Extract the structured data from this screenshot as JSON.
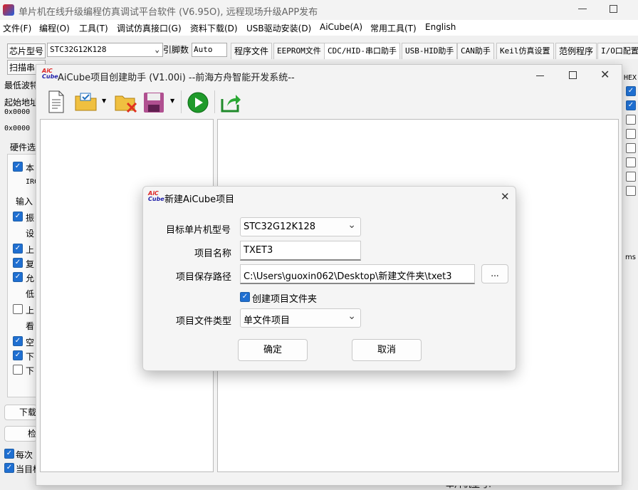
{
  "main_window": {
    "title": "单片机在线升级编程仿真调试平台软件 (V6.95O), 远程现场升级APP发布",
    "menu": [
      "文件(F)",
      "编程(O)",
      "工具(T)",
      "调试仿真接口(G)",
      "资料下载(D)",
      "USB驱动安装(D)",
      "AiCube(A)",
      "常用工具(T)",
      "English"
    ],
    "chip_label": "芯片型号",
    "chip_value": "STC32G12K128",
    "pins_label": "引脚数",
    "pins_value": "Auto",
    "scan_button": "扫描串口",
    "min_baud_label": "最低波特",
    "start_addr_label": "起始地址",
    "addr1": "0x0000",
    "addr2": "0x0000",
    "hw_options_label": "硬件选",
    "left_items": [
      "本",
      "IRC",
      "输入",
      "振",
      "设",
      "上",
      "复",
      "允",
      "低",
      "上",
      "看",
      "空",
      "下",
      "下"
    ],
    "download_btn": "下载",
    "check_btn": "检",
    "every_time": "每次",
    "current_target": "当目标",
    "tabs": [
      "程序文件",
      "EEPROM文件",
      "CDC/HID-串口助手",
      "USB-HID助手",
      "CAN助手",
      "Keil仿真设置",
      "范例程序",
      "I/O口配置"
    ],
    "hex_label": "HEX",
    "ms_label": "ms",
    "mcu_model_label": "单片机型号:"
  },
  "aicube_window": {
    "title": "AiCube项目创建助手 (V1.00i) --前海方舟智能开发系统--",
    "logo_top": "AiC",
    "logo_bottom": "Cube"
  },
  "dialog": {
    "title": "新建AiCube项目",
    "target_mcu_label": "目标单片机型号",
    "target_mcu_value": "STC32G12K128",
    "project_name_label": "项目名称",
    "project_name_value": "TXET3",
    "save_path_label": "项目保存路径",
    "save_path_value": "C:\\Users\\guoxin062\\Desktop\\新建文件夹\\txet3",
    "browse_button": "...",
    "create_folder_label": "创建项目文件夹",
    "file_type_label": "项目文件类型",
    "file_type_value": "单文件项目",
    "ok_button": "确定",
    "cancel_button": "取消"
  }
}
